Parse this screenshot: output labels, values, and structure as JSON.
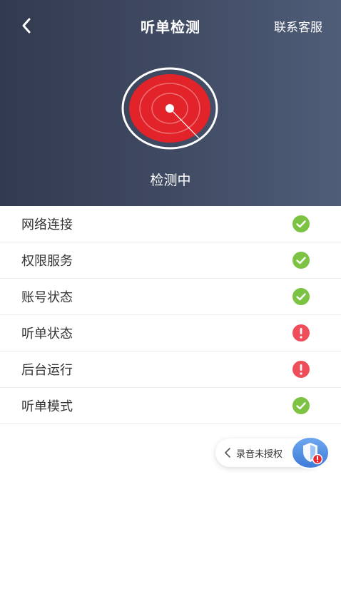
{
  "header": {
    "title": "听单检测",
    "contact_label": "联系客服",
    "status_text": "检测中"
  },
  "colors": {
    "ok": "#7cc243",
    "error": "#ef4d5a",
    "radar_red": "#e2232a",
    "header_dark": "#323a4f",
    "header_light": "#4f5d78"
  },
  "checks": [
    {
      "label": "网络连接",
      "status": "ok",
      "icon": "check-circle-icon"
    },
    {
      "label": "权限服务",
      "status": "ok",
      "icon": "check-circle-icon"
    },
    {
      "label": "账号状态",
      "status": "ok",
      "icon": "check-circle-icon"
    },
    {
      "label": "听单状态",
      "status": "error",
      "icon": "alert-circle-icon"
    },
    {
      "label": "后台运行",
      "status": "error",
      "icon": "alert-circle-icon"
    },
    {
      "label": "听单模式",
      "status": "ok",
      "icon": "check-circle-icon"
    }
  ],
  "float_widget": {
    "text": "录音未授权",
    "icon": "shield-icon"
  }
}
